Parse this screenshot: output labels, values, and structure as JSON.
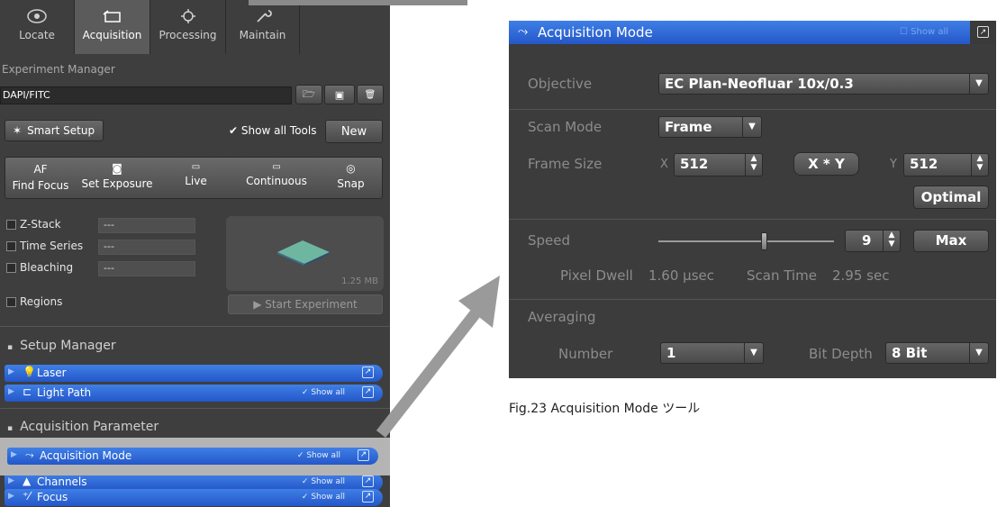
{
  "tabs": [
    {
      "label": "Locate",
      "icon": "locate-icon"
    },
    {
      "label": "Acquisition",
      "icon": "acquisition-icon"
    },
    {
      "label": "Processing",
      "icon": "processing-icon"
    },
    {
      "label": "Maintain",
      "icon": "maintain-icon"
    }
  ],
  "experiment": {
    "label": "Experiment Manager",
    "value": "DAPI/FITC"
  },
  "smart_setup": "Smart Setup",
  "show_all_tools": {
    "label": "Show all Tools",
    "checked": true
  },
  "new_button": "New",
  "actions": [
    {
      "top": "AF",
      "label": "Find Focus",
      "icon": "af-text"
    },
    {
      "top": "",
      "label": "Set Exposure",
      "icon": "camera-icon"
    },
    {
      "top": "",
      "label": "Live",
      "icon": "live-icon"
    },
    {
      "top": "",
      "label": "Continuous",
      "icon": "continuous-icon"
    },
    {
      "top": "",
      "label": "Snap",
      "icon": "snap-icon"
    }
  ],
  "options": [
    {
      "label": "Z-Stack",
      "value": "---"
    },
    {
      "label": "Time Series",
      "value": "---"
    },
    {
      "label": "Bleaching",
      "value": "---"
    },
    {
      "label": "Regions",
      "value": ""
    }
  ],
  "preview_size": "1.25 MB",
  "start_experiment": "Start Experiment",
  "setup_manager": {
    "title": "Setup Manager",
    "items": [
      {
        "label": "Laser",
        "icon": "laser-icon",
        "show_all": ""
      },
      {
        "label": "Light Path",
        "icon": "light-path-icon",
        "show_all": "✓ Show all"
      }
    ]
  },
  "acq_param": {
    "title": "Acquisition Parameter",
    "items": [
      {
        "label": "Acquisition Mode",
        "icon": "acquisition-mode-icon",
        "show_all": "✓ Show all"
      },
      {
        "label": "Channels",
        "icon": "channels-icon",
        "show_all": "✓ Show all"
      },
      {
        "label": "Focus",
        "icon": "focus-icon",
        "show_all": "✓ Show all"
      }
    ]
  },
  "colors": {
    "accent_blue": "#2f6ad8",
    "highlight_gray": "#b4b4b4",
    "panel_dark": "#3e3e3e"
  },
  "acq_mode": {
    "title": "Acquisition Mode",
    "show_all": "Show all",
    "objective_label": "Objective",
    "objective_value": "EC Plan-Neofluar 10x/0.3",
    "scan_mode_label": "Scan Mode",
    "scan_mode_value": "Frame",
    "frame_size_label": "Frame Size",
    "x_label": "X",
    "x_value": "512",
    "xy_button": "X * Y",
    "y_label": "Y",
    "y_value": "512",
    "optimal": "Optimal",
    "speed_label": "Speed",
    "speed_value": "9",
    "speed_fraction": 0.6,
    "max": "Max",
    "pixel_dwell_label": "Pixel Dwell",
    "pixel_dwell_value": "1.60 µsec",
    "scan_time_label": "Scan Time",
    "scan_time_value": "2.95 sec",
    "averaging_label": "Averaging",
    "number_label": "Number",
    "number_value": "1",
    "bit_depth_label": "Bit Depth",
    "bit_depth_value": "8 Bit"
  },
  "caption": "Fig.23  Acquisition Mode ツール"
}
